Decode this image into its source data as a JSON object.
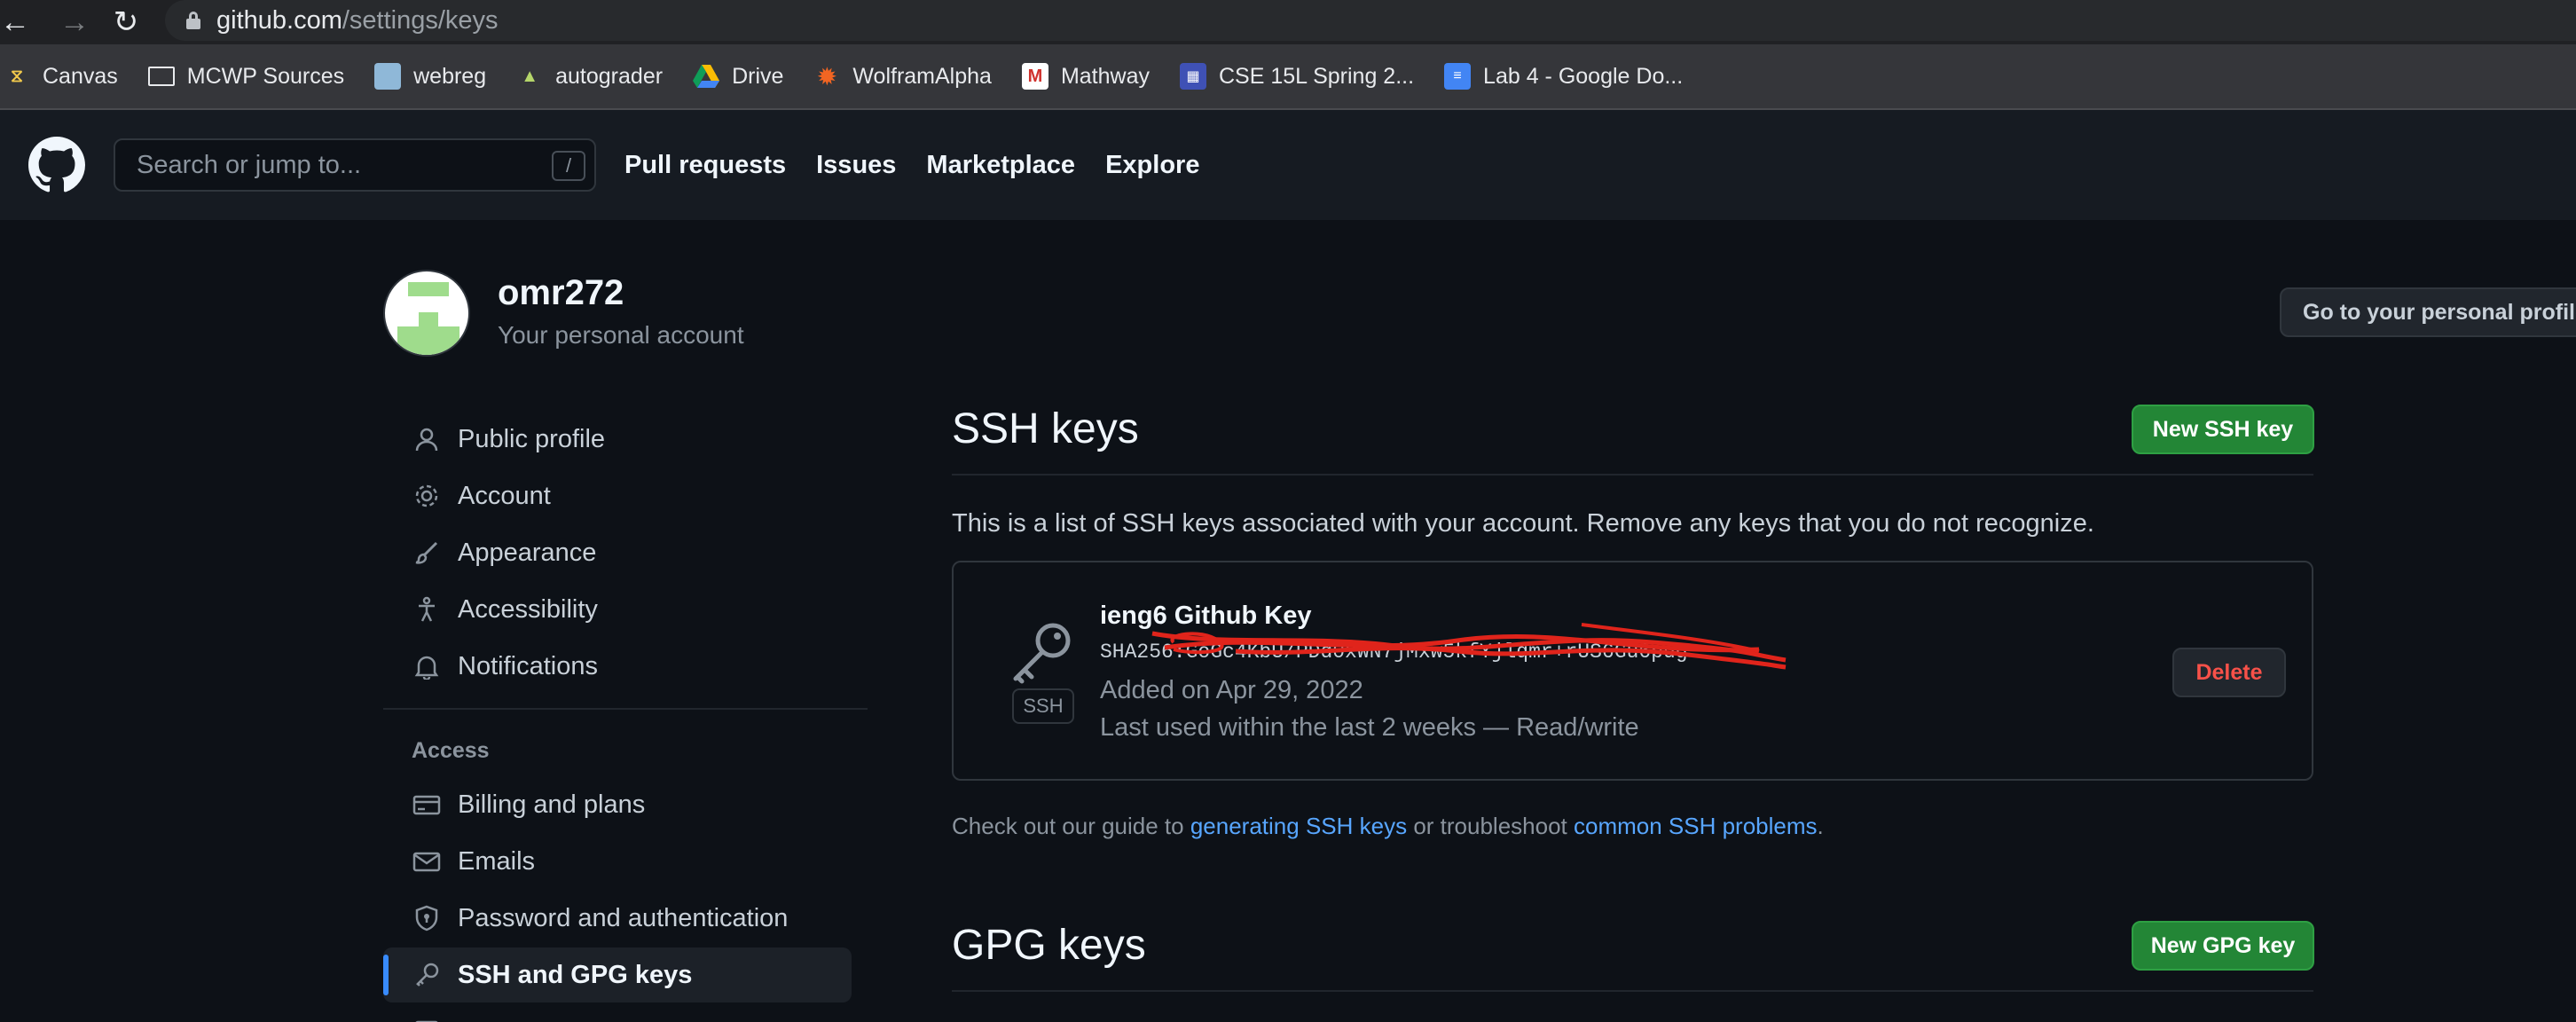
{
  "browser": {
    "url_host": "github.com",
    "url_path": "/settings/keys",
    "bookmarks": [
      {
        "label": "Canvas",
        "icon": "canvas-icon"
      },
      {
        "label": "MCWP Sources",
        "icon": "folder-icon"
      },
      {
        "label": "webreg",
        "icon": "webreg-icon"
      },
      {
        "label": "autograder",
        "icon": "autograder-icon"
      },
      {
        "label": "Drive",
        "icon": "drive-icon"
      },
      {
        "label": "WolframAlpha",
        "icon": "wolframalpha-icon"
      },
      {
        "label": "Mathway",
        "icon": "mathway-icon"
      },
      {
        "label": "CSE 15L Spring 2...",
        "icon": "calendar-icon"
      },
      {
        "label": "Lab 4 - Google Do...",
        "icon": "google-docs-icon"
      }
    ]
  },
  "header": {
    "search_placeholder": "Search or jump to...",
    "search_shortcut": "/",
    "nav": [
      "Pull requests",
      "Issues",
      "Marketplace",
      "Explore"
    ]
  },
  "profile": {
    "username": "omr272",
    "subtitle": "Your personal account",
    "profile_button": "Go to your personal profile"
  },
  "sidebar": {
    "items": [
      {
        "label": "Public profile",
        "icon": "person-icon"
      },
      {
        "label": "Account",
        "icon": "gear-icon"
      },
      {
        "label": "Appearance",
        "icon": "paintbrush-icon"
      },
      {
        "label": "Accessibility",
        "icon": "accessibility-icon"
      },
      {
        "label": "Notifications",
        "icon": "bell-icon"
      }
    ],
    "access_heading": "Access",
    "access_items": [
      {
        "label": "Billing and plans",
        "icon": "credit-card-icon"
      },
      {
        "label": "Emails",
        "icon": "mail-icon"
      },
      {
        "label": "Password and authentication",
        "icon": "shield-lock-icon"
      },
      {
        "label": "SSH and GPG keys",
        "icon": "key-icon",
        "active": true
      }
    ]
  },
  "ssh": {
    "title": "SSH keys",
    "new_button": "New SSH key",
    "description": "This is a list of SSH keys associated with your account. Remove any keys that you do not recognize.",
    "key": {
      "badge": "SSH",
      "name": "ieng6 Github Key",
      "fingerprint": "SHA256:GoGc4KbU/PDd0xWN7jMxw5kfYjlqmr+rUS6Gu6pug",
      "added": "Added on Apr 29, 2022",
      "last_used": "Last used within the last 2 weeks — Read/write",
      "delete_button": "Delete"
    },
    "guide_prefix": "Check out our guide to ",
    "guide_link1": "generating SSH keys",
    "guide_middle": " or troubleshoot ",
    "guide_link2": "common SSH problems",
    "guide_suffix": "."
  },
  "gpg": {
    "title": "GPG keys",
    "new_button": "New GPG key"
  },
  "colors": {
    "accent_green": "#238636",
    "link_blue": "#58a6ff",
    "danger_red": "#f85149",
    "active_indicator": "#388bfd"
  }
}
